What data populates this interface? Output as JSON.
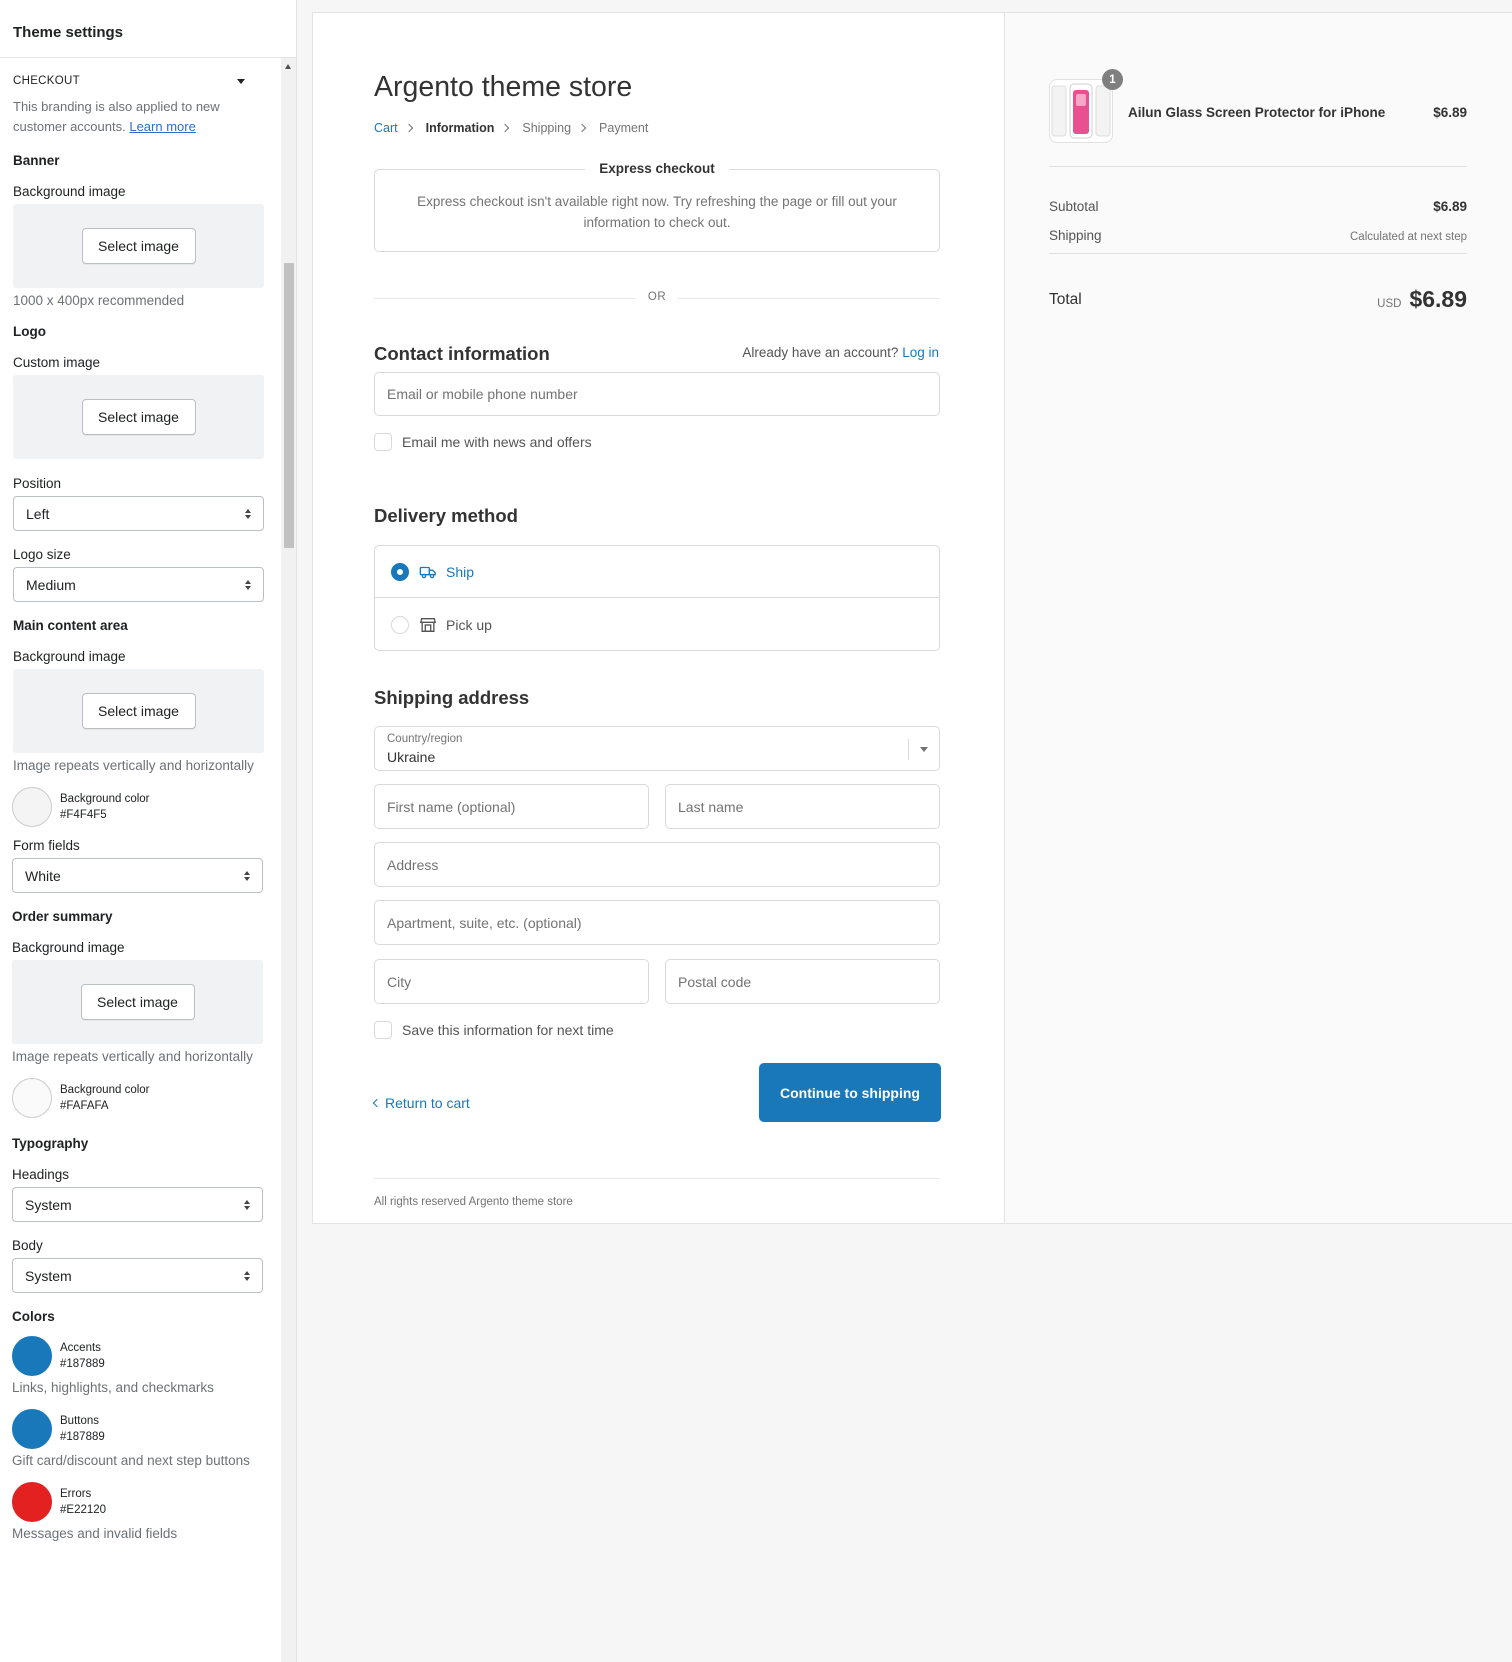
{
  "sidebar": {
    "title": "Theme settings",
    "section": "CHECKOUT",
    "branding_text": "This branding is also applied to new customer accounts.",
    "learn_more": "Learn more",
    "banner": {
      "heading": "Banner",
      "bg_label": "Background image",
      "select": "Select image",
      "help": "1000 x 400px recommended"
    },
    "logo": {
      "heading": "Logo",
      "custom_label": "Custom image",
      "select": "Select image",
      "position_label": "Position",
      "position_value": "Left",
      "size_label": "Logo size",
      "size_value": "Medium"
    },
    "main_content": {
      "heading": "Main content area",
      "bg_label": "Background image",
      "select": "Select image",
      "help": "Image repeats vertically and horizontally",
      "color_label": "Background color",
      "color_value": "#F4F4F5",
      "form_fields_label": "Form fields",
      "form_fields_value": "White"
    },
    "order_summary": {
      "heading": "Order summary",
      "bg_label": "Background image",
      "select": "Select image",
      "help": "Image repeats vertically and horizontally",
      "color_label": "Background color",
      "color_value": "#FAFAFA"
    },
    "typography": {
      "heading": "Typography",
      "headings_label": "Headings",
      "headings_value": "System",
      "body_label": "Body",
      "body_value": "System"
    },
    "colors": {
      "heading": "Colors",
      "accents_label": "Accents",
      "accents_value": "#187889",
      "accents_help": "Links, highlights, and checkmarks",
      "buttons_label": "Buttons",
      "buttons_value": "#187889",
      "buttons_help": "Gift card/discount and next step buttons",
      "errors_label": "Errors",
      "errors_value": "#E22120",
      "errors_help": "Messages and invalid fields"
    }
  },
  "checkout": {
    "store_title": "Argento theme store",
    "breadcrumbs": [
      "Cart",
      "Information",
      "Shipping",
      "Payment"
    ],
    "express_title": "Express checkout",
    "express_msg": "Express checkout isn't available right now. Try refreshing the page or fill out your information to check out.",
    "or": "OR",
    "contact_title": "Contact information",
    "have_account": "Already have an account?",
    "login": "Log in",
    "email_placeholder": "Email or mobile phone number",
    "news_checkbox": "Email me with news and offers",
    "delivery_title": "Delivery method",
    "ship": "Ship",
    "pickup": "Pick up",
    "shipping_title": "Shipping address",
    "country_label": "Country/region",
    "country_value": "Ukraine",
    "first_name": "First name (optional)",
    "last_name": "Last name",
    "address": "Address",
    "apartment": "Apartment, suite, etc. (optional)",
    "city": "City",
    "postal": "Postal code",
    "save_info": "Save this information for next time",
    "return_cart": "Return to cart",
    "continue": "Continue to shipping",
    "footer": "All rights reserved Argento theme store"
  },
  "summary": {
    "quantity": "1",
    "product_name": "Ailun Glass Screen Protector for iPhone",
    "product_price": "$6.89",
    "subtotal_label": "Subtotal",
    "subtotal_value": "$6.89",
    "shipping_label": "Shipping",
    "shipping_value": "Calculated at next step",
    "total_label": "Total",
    "currency": "USD",
    "total_value": "$6.89"
  },
  "colors": {
    "accent": "#1878b9",
    "swatch_main_bg": "#F4F4F5",
    "swatch_summary_bg": "#FAFAFA",
    "swatch_accents": "#1878b9",
    "swatch_buttons": "#1878b9",
    "swatch_errors": "#e22120"
  }
}
